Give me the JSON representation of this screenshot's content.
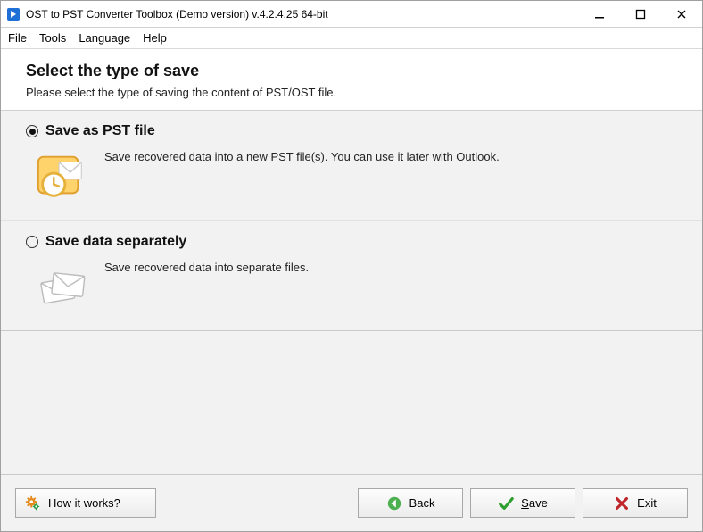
{
  "titlebar": {
    "title": "OST to PST Converter Toolbox (Demo version) v.4.2.4.25 64-bit"
  },
  "menus": {
    "file": "File",
    "tools": "Tools",
    "language": "Language",
    "help": "Help"
  },
  "header": {
    "title": "Select the type of save",
    "subtitle": "Please select the type of saving the content of PST/OST file."
  },
  "options": {
    "pst": {
      "title": "Save as PST file",
      "desc": "Save recovered data into a new PST file(s). You can use it later with Outlook."
    },
    "sep": {
      "title": "Save data separately",
      "desc": "Save recovered data into separate files."
    }
  },
  "footer": {
    "how": "How it works?",
    "back": "Back",
    "save_prefix": "S",
    "save_rest": "ave",
    "exit": "Exit"
  }
}
